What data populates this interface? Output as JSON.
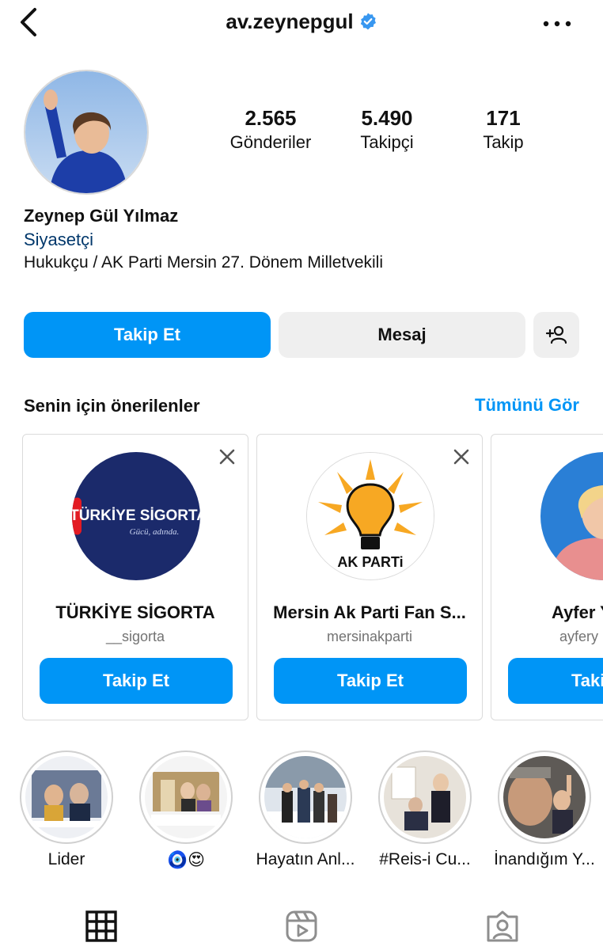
{
  "header": {
    "username": "av.zeynepgul",
    "icons": {
      "back": "chevron-left-icon",
      "verified": "verified-badge-icon",
      "more": "more-horizontal-icon"
    }
  },
  "profile": {
    "stats": [
      {
        "value": "2.565",
        "label": "Gönderiler"
      },
      {
        "value": "5.490",
        "label": "Takipçi"
      },
      {
        "value": "171",
        "label": "Takip"
      }
    ],
    "name": "Zeynep Gül Yılmaz",
    "category": "Siyasetçi",
    "bio": "Hukukçu / AK Parti Mersin 27. Dönem Milletvekili"
  },
  "actions": {
    "follow": "Takip Et",
    "message": "Mesaj",
    "add_user_icon": "add-person-icon"
  },
  "suggestions": {
    "title": "Senin için önerilenler",
    "see_all": "Tümünü Gör",
    "cards": [
      {
        "name": "TÜRKİYE SİGORTA",
        "handle": "__sigorta",
        "button": "Takip Et",
        "logo_text": "TÜRKİYE SİGORTA",
        "logo_sub": "Gücü, adında."
      },
      {
        "name": "Mersin Ak Parti Fan S...",
        "handle": "mersinakparti",
        "button": "Takip Et",
        "logo_text": "AK PARTi"
      },
      {
        "name": "Ayfer Y",
        "handle": "ayfery",
        "button": "Taki"
      }
    ]
  },
  "highlights": [
    {
      "label": "Lider"
    },
    {
      "label": "🧿😍"
    },
    {
      "label": "Hayatın Anl..."
    },
    {
      "label": "#Reis-i Cu..."
    },
    {
      "label": "İnandığım Y..."
    }
  ],
  "tabs": {
    "icons": [
      "grid-icon",
      "reels-icon",
      "tagged-icon"
    ]
  },
  "colors": {
    "accent": "#0095f6",
    "secondary_button": "#efefef",
    "category_text": "#00376b",
    "muted": "#737373"
  }
}
